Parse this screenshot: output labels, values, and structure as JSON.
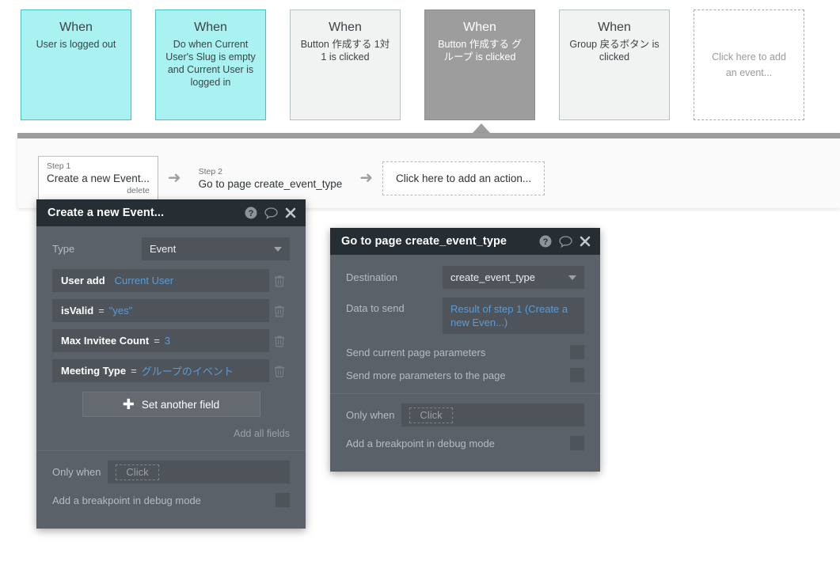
{
  "events": [
    {
      "when": "When",
      "desc": "User is logged out",
      "style": "cyan"
    },
    {
      "when": "When",
      "desc": "Do when Current User's Slug is empty and Current User is logged in",
      "style": "cyan"
    },
    {
      "when": "When",
      "desc": "Button 作成する 1対1 is clicked",
      "style": "gray"
    },
    {
      "when": "When",
      "desc": "Button 作成する グループ is clicked",
      "style": "selected"
    },
    {
      "when": "When",
      "desc": "Group 戻るボタン is clicked",
      "style": "gray"
    },
    {
      "add_label": "Click here to add an event...",
      "style": "add"
    }
  ],
  "workflow": {
    "steps": [
      {
        "num": "Step 1",
        "title": "Create a new Event...",
        "delete_label": "delete"
      },
      {
        "num": "Step 2",
        "title": "Go to page create_event_type"
      }
    ],
    "add_action_label": "Click here to add an action...",
    "arrow_glyph": "➜"
  },
  "panel_create": {
    "title": "Create a new Event...",
    "type_label": "Type",
    "type_value": "Event",
    "fields": [
      {
        "key": "User add",
        "op": "",
        "value": "Current User"
      },
      {
        "key": "isValid",
        "op": "=",
        "value": "\"yes\""
      },
      {
        "key": "Max Invitee Count",
        "op": "=",
        "value": "3"
      },
      {
        "key": "Meeting Type",
        "op": "=",
        "value": "グループのイベント"
      }
    ],
    "set_another_field_label": "Set another field",
    "add_all_fields_label": "Add all fields",
    "only_when_label": "Only when",
    "only_when_placeholder": "Click",
    "breakpoint_label": "Add a breakpoint in debug mode"
  },
  "panel_goto": {
    "title": "Go to page create_event_type",
    "destination_label": "Destination",
    "destination_value": "create_event_type",
    "data_to_send_label": "Data to send",
    "data_to_send_value": "Result of step 1 (Create a new Even...)",
    "send_current_params_label": "Send current page parameters",
    "send_more_params_label": "Send more parameters to the page",
    "only_when_label": "Only when",
    "only_when_placeholder": "Click",
    "breakpoint_label": "Add a breakpoint in debug mode"
  },
  "icons": {
    "help": "help-icon",
    "comment": "comment-icon",
    "close": "close-icon",
    "trash": "trash-icon"
  },
  "colors": {
    "event_cyan": "#aaf2f2",
    "event_selected": "#9d9d9d",
    "panel_bg": "#5b6168",
    "panel_header": "#272e33",
    "value_blue": "#5b9bd8"
  }
}
